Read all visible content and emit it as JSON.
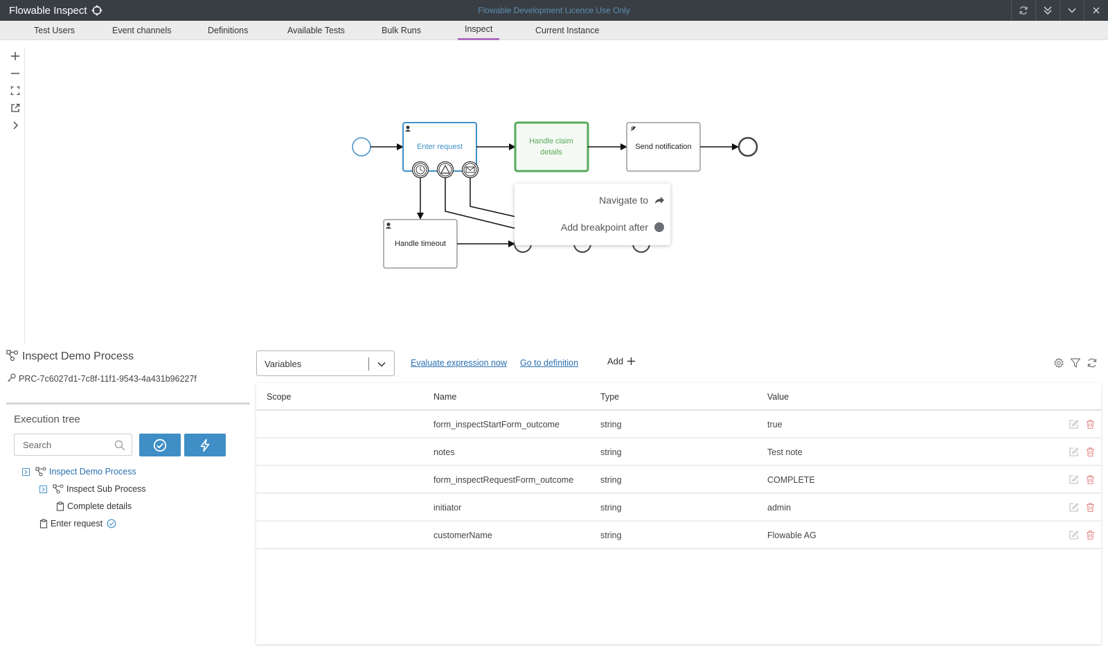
{
  "window": {
    "title": "Flowable Inspect",
    "licence_notice": "Flowable Development Licence Use Only"
  },
  "tabs": [
    {
      "label": "Test Users"
    },
    {
      "label": "Event channels"
    },
    {
      "label": "Definitions"
    },
    {
      "label": "Available Tests"
    },
    {
      "label": "Bulk Runs"
    },
    {
      "label": "Inspect",
      "active": true
    },
    {
      "label": "Current Instance"
    }
  ],
  "diagram": {
    "tasks": {
      "enter_request": "Enter request",
      "handle_claim": [
        "Handle claim",
        "details"
      ],
      "send_notification": "Send notification",
      "handle_timeout": "Handle timeout"
    },
    "active_task": "Handle claim details",
    "context_menu": {
      "navigate_to": "Navigate to",
      "add_breakpoint": "Add breakpoint after"
    }
  },
  "process": {
    "title": "Inspect Demo Process",
    "id": "PRC-7c6027d1-7c8f-11f1-9543-4a431b96227f"
  },
  "execution_tree": {
    "title": "Execution tree",
    "search_placeholder": "Search",
    "nodes": [
      {
        "label": "Inspect Demo Process",
        "level": 0,
        "type": "process",
        "link": true
      },
      {
        "label": "Inspect Sub Process",
        "level": 1,
        "type": "process"
      },
      {
        "label": "Complete details",
        "level": 2,
        "type": "task"
      },
      {
        "label": "Enter request",
        "level": 1,
        "type": "task",
        "checked": true
      }
    ]
  },
  "variables": {
    "selector_value": "Variables",
    "links": {
      "evaluate": "Evaluate expression now",
      "definition": "Go to definition"
    },
    "add_label": "Add",
    "columns": [
      "Scope",
      "Name",
      "Type",
      "Value"
    ],
    "rows": [
      {
        "scope": "",
        "name": "form_inspectStartForm_outcome",
        "type": "string",
        "value": "true"
      },
      {
        "scope": "",
        "name": "notes",
        "type": "string",
        "value": "Test note"
      },
      {
        "scope": "",
        "name": "form_inspectRequestForm_outcome",
        "type": "string",
        "value": "COMPLETE"
      },
      {
        "scope": "",
        "name": "initiator",
        "type": "string",
        "value": "admin"
      },
      {
        "scope": "",
        "name": "customerName",
        "type": "string",
        "value": "Flowable AG"
      }
    ]
  },
  "colors": {
    "accent": "#3f8fc6",
    "active_green": "#58a95a",
    "delete_red": "#e58c8c",
    "tab_underline": "#b06fbc"
  }
}
